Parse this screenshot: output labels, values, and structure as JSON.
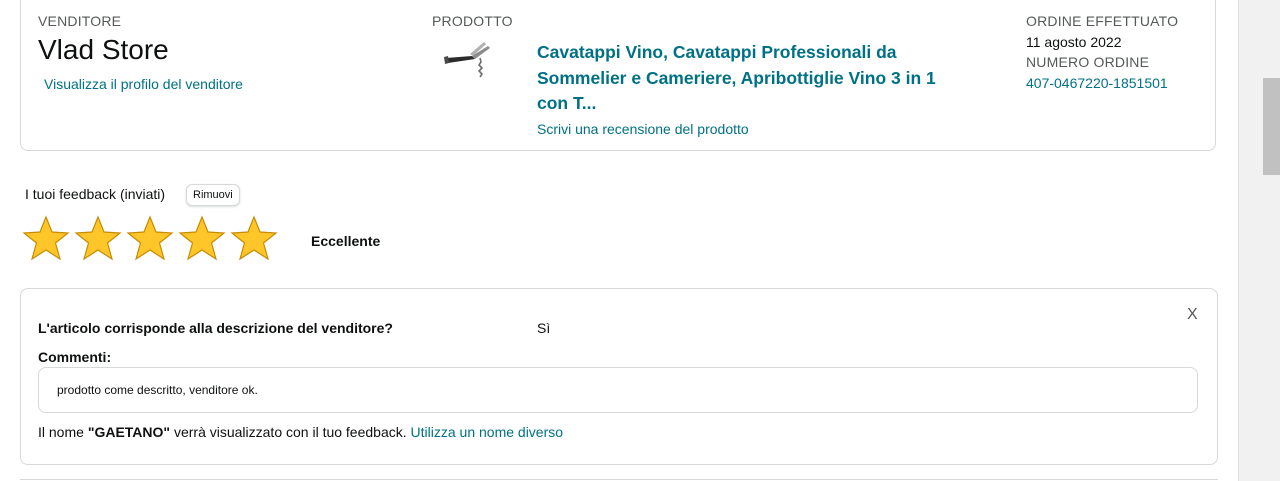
{
  "seller": {
    "label": "VENDITORE",
    "name": "Vlad Store",
    "profile_link": "Visualizza il profilo del venditore"
  },
  "product": {
    "label": "PRODOTTO",
    "title": "Cavatappi Vino, Cavatappi Professionali da Sommelier e Cameriere, Apribottiglie Vino 3 in 1 con T...",
    "review_link": "Scrivi una recensione del prodotto",
    "image_icon": "corkscrew-image"
  },
  "order": {
    "placed_label": "ORDINE EFFETTUATO",
    "placed_date": "11 agosto 2022",
    "number_label": "NUMERO ORDINE",
    "number": "407-0467220-1851501"
  },
  "feedback": {
    "label": "I tuoi feedback (inviati)",
    "remove_button": "Rimuovi",
    "rating": 5,
    "max_rating": 5,
    "rating_text": "Eccellente",
    "star_color": "#ffc629",
    "star_outline": "#c78a00"
  },
  "details": {
    "close_label": "X",
    "question": "L'articolo corrisponde alla descrizione del venditore?",
    "answer": "Sì",
    "comments_label": "Commenti:",
    "comment": "prodotto come descritto, venditore ok.",
    "name_prefix": "Il nome ",
    "name": "\"GAETANO\"",
    "name_suffix": " verrà visualizzato con il tuo feedback. ",
    "name_link": "Utilizza un nome diverso"
  },
  "colors": {
    "link": "#007185",
    "text": "#0f1111",
    "muted": "#565959",
    "border": "#d5d9d9"
  }
}
